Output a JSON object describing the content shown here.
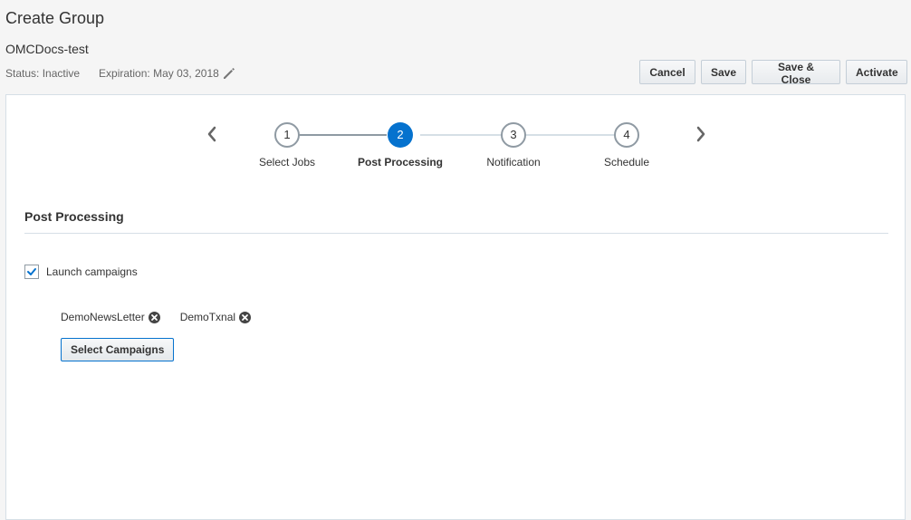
{
  "header": {
    "title": "Create Group",
    "group_name": "OMCDocs-test",
    "status": "Status: Inactive",
    "expiration": "Expiration: May 03, 2018"
  },
  "toolbar": {
    "cancel_label": "Cancel",
    "save_label": "Save",
    "save_close_label": "Save & Close",
    "activate_label": "Activate"
  },
  "train": {
    "current_step": 2,
    "steps": [
      {
        "number": "1",
        "label": "Select Jobs"
      },
      {
        "number": "2",
        "label": "Post Processing"
      },
      {
        "number": "3",
        "label": "Notification"
      },
      {
        "number": "4",
        "label": "Schedule"
      }
    ]
  },
  "section": {
    "title": "Post Processing",
    "launch_checkbox_label": "Launch campaigns",
    "launch_checked": true,
    "campaigns": [
      "DemoNewsLetter",
      "DemoTxnal"
    ],
    "select_button_label": "Select Campaigns"
  },
  "colors": {
    "accent": "#0572ce",
    "page_background": "#f5f5f5",
    "panel_border": "#d6dfe6"
  }
}
